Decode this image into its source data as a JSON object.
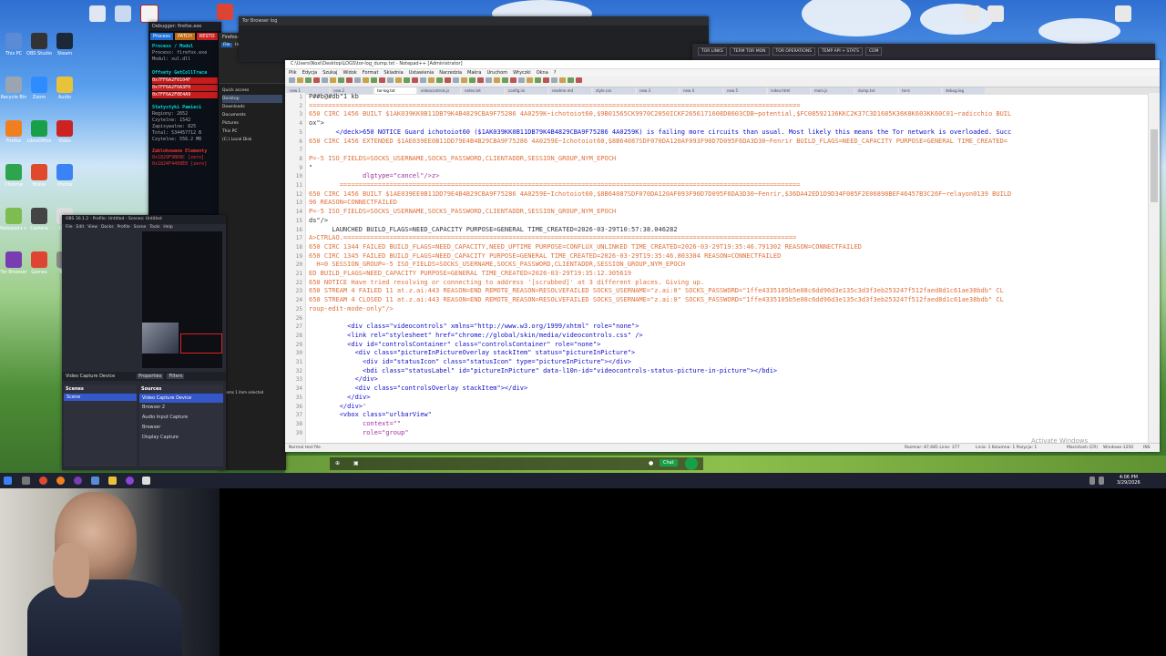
{
  "desktop": {
    "icon_labels": [
      "This PC",
      "Recycle Bin",
      "Firefox",
      "Chrome",
      "Notepad++",
      "Tor Browser",
      "OBS Studio",
      "Zoom",
      "LibreOffice",
      "Brave",
      "Camera",
      "Games",
      "Steam",
      "Audio",
      "Video",
      "Photos",
      "Docs",
      "Tools"
    ]
  },
  "debugger_window": {
    "title": "Debugger: firefox.exe",
    "tabs": [
      "Process",
      "PATCH",
      "RESTO"
    ],
    "module_header": "Process / Modul",
    "process_line": "Process: firefox.exe",
    "module_line": "Modul: xul.dll",
    "offsets_header": "Offsety GetCollTrace",
    "offsets": [
      "0x7FF6A2F0104F",
      "0x7FF6A2F0A3F0",
      "0x7FF6A2F0E4A9"
    ],
    "stats_header": "Statystyki Pamieci",
    "stats": [
      "Regiony: 2652",
      "Czytelne: 1542",
      "Zapisywalne: 825",
      "Total: 534457712 B",
      "Czytelne: 556.2 MB"
    ],
    "blocked_header": "Zablokowane Elementy",
    "blocked": [
      "0x1829F9BD8C [zero]",
      "0x1824F4499E0 [zero]"
    ]
  },
  "explorer": {
    "title": "Firefox-Installer.exe",
    "ribbon_tabs": [
      "File",
      "Home",
      "Share",
      "View"
    ],
    "nav_items": [
      "Quick access",
      "Desktop",
      "Downloads",
      "Documents",
      "Pictures",
      "This PC",
      "(C:) Local Disk"
    ],
    "status": "3 items  1 item selected"
  },
  "obs": {
    "title": "OBS 30.1.2 - Profile: Untitled - Scenes: Untitled",
    "menu": [
      "File",
      "Edit",
      "View",
      "Docks",
      "Profile",
      "Scene",
      "Tools",
      "Help"
    ],
    "source_label": "Video Capture Device",
    "properties_label": "Properties",
    "filters_label": "Filters",
    "scenes_header": "Scenes",
    "sources_header": "Sources",
    "scenes": [
      "Scene"
    ],
    "sources": [
      "Video Capture Device",
      "Browser 2",
      "Audio Input Capture",
      "Browser",
      "Display Capture"
    ]
  },
  "tor_log_window": {
    "title": "Tor Browser log"
  },
  "browser_strip": {
    "tabs": [
      "TOR LINKS",
      "TERM TOR MON",
      "TOR OPERATIONS",
      "TEMP API + STATS",
      "CDM"
    ]
  },
  "editor": {
    "title": "C:\\Users\\Noxi\\Desktop\\LOGS\\tor-log_dump.txt - Notepad++ [Administrator]",
    "menu": [
      "Plik",
      "Edycja",
      "Szukaj",
      "Widok",
      "Format",
      "Skladnia",
      "Ustawienia",
      "Narzedzia",
      "Makra",
      "Uruchom",
      "Wtyczki",
      "Okna",
      "?"
    ],
    "tabs": [
      "new 1",
      "new 2",
      "tor-log.txt",
      "videocontrols.js",
      "notes.txt",
      "config.ini",
      "readme.md",
      "style.css",
      "new 3",
      "new 4",
      "new 5",
      "index.html",
      "main.js",
      "dump.txt",
      "torrc",
      "debug.log"
    ],
    "active_tab": "tor-log.txt",
    "line_numbers": [
      "1",
      "2",
      "3",
      "4",
      "5",
      "6",
      "7",
      "8",
      "9",
      "10",
      "11",
      "12",
      "13",
      "14",
      "15",
      "16",
      "17",
      "18",
      "19",
      "20",
      "21",
      "22",
      "23",
      "24",
      "25",
      "26",
      "27",
      "28",
      "29",
      "30",
      "31",
      "32",
      "33",
      "34",
      "35",
      "36",
      "37",
      "38",
      "39"
    ],
    "lines": [
      "P##b@#db\"1 kb",
      "================================================================================================================================",
      "650 CIRC 1456 BUILT $1AK039KK0B11DB79K4B4829CBA9F75286 4A0259K~ichotoiot60,$9B01565CK9970C2050ICKF2656171608D8603CDB~potential,$FC08592136KKC2K37C3D1685K36K8K603KK60C01~radicchio BUIL",
      "ox\">",
      "       </deck>650 NOTICE Guard ichotoiot60 ($1AK039KK0B11DB79K4B4829CBA9F75286 4A0259K) is failing more circuits than usual. Most likely this means the Tor network is overloaded. Succ",
      "650 CIRC 1456 EXTENDED $1AE039EE0B11DD79E4B4B29CBA9F75286 4A0259E~Ichotoiot60,$8B64087SDF070DA120AF093F90D7D095F6DA3D30~Fenrir BUILD_FLAGS=NEED_CAPACITY PURPOSE=GENERAL TIME_CREATED=",
      "",
      "P=-5 ISO_FIELDS=SOCKS_USERNAME,SOCKS_PASSWORD,CLIENTADDR,SESSION_GROUP,NYM_EPOCH",
      "\"",
      "              dlgtype=\"cancel\"/>z>",
      "        ========================================================================================================================",
      "650 CIRC 1456 BUILT $1AE039EE0B11DD79E4B4B29CBA9F75286 4A0259E~Ichotoiot60,$8B64087SDF070DA120AF093F90D7D095F6DA3D30~Fenrir,$36DA42ED1D9D34F085F2E06898BEF46457B3C26F~relayon0139 BUILD",
      "96 REASON=CONNECTFAILED",
      "P=-5 ISO_FIELDS=SOCKS_USERNAME,SOCKS_PASSWORD,CLIENTADDR,SESSION_GROUP,NYM_EPOCH",
      "ds\"/>",
      "      LAUNCHED BUILD_FLAGS=NEED_CAPACITY PURPOSE=GENERAL TIME_CREATED=2026-03-29T10:57:38.046282",
      "A>CTRLAO.======================================================================================================================",
      "650 CIRC 1344 FAILED BUILD_FLAGS=NEED_CAPACITY,NEED_UPTIME PURPOSE=CONFLUX_UNLINKED TIME_CREATED=2026-03-29T19:35:46.791302 REASON=CONNECTFAILED",
      "650 CIRC 1345 FAILED BUILD_FLAGS=NEED_CAPACITY PURPOSE=GENERAL TIME_CREATED=2026-03-29T19:35:46.803304 REASON=CONNECTFAILED",
      "  H=0 SESSION_GROUP=-5 ISO_FIELDS=SOCKS_USERNAME,SOCKS_PASSWORD,CLIENTADDR,SESSION_GROUP,NYM_EPOCH",
      "ED BUILD_FLAGS=NEED_CAPACITY PURPOSE=GENERAL TIME_CREATED=2026-03-29T19:35:12.305619",
      "650 NOTICE Have tried resolving or connecting to address '[scrubbed]' at 3 different places. Giving up.",
      "650 STREAM 4 FAILED 11 at.z.ai:443 REASON=END REMOTE_REASON=RESOLVEFAILED SOCKS_USERNAME=\"z.ai:0\" SOCKS_PASSWORD=\"1ffe4335105b5e08c6dd96d3e135c3d3f3eb253247f512faed8d1c61ae38bdb\" CL",
      "650 STREAM 4 CLOSED 11 at.z.ai:443 REASON=END REMOTE_REASON=RESOLVEFAILED SOCKS_USERNAME=\"z.ai:0\" SOCKS_PASSWORD=\"1ffe4335105b5e08c6dd96d3e135c3d3f3eb253247f512faed8d1c61ae38bdb\" CL",
      "roup-edit-mode-only\"/>",
      "",
      "          <div class=\"videocontrols\" xmlns=\"http://www.w3.org/1999/xhtml\" role=\"none\">",
      "          <link rel=\"stylesheet\" href=\"chrome://global/skin/media/videocontrols.css\" />",
      "          <div id=\"controlsContainer\" class=\"controlsContainer\" role=\"none\">",
      "            <div class=\"pictureInPictureOverlay stackItem\" status=\"pictureInPicture\">",
      "              <div id=\"statusIcon\" class=\"statusIcon\" type=\"pictureInPicture\"></div>",
      "              <bdi class=\"statusLabel\" id=\"pictureInPicture\" data-l10n-id=\"videocontrols-status-picture-in-picture\"></bdi>",
      "            </div>",
      "            <div class=\"controlsOverlay stackItem\"></div>",
      "          </div>",
      "        </div>'",
      "        <vbox class=\"urlbarView\"",
      "              context=\"\"",
      "              role=\"group\""
    ],
    "status_left": "Normal text file",
    "status_mid": "Rozmiar: 87,685   Linie: 377",
    "status_pos": "Linia: 1   Kolumna: 1   Pozycja: 1",
    "status_eol": "Macintosh (CR)",
    "status_enc": "Windows-1250",
    "status_mode": "INS"
  },
  "activate_windows": "Activate Windows",
  "taskbar": {
    "chat_label": "Chat",
    "time": "4:06 PM",
    "date": "3/29/2026"
  },
  "colors": {
    "editor_bg": "#ffffff",
    "orange_text": "#e0703a",
    "blue_keyword": "#1010c8",
    "purple_attr": "#a030a0",
    "debugger_header": "#00c8c8",
    "chat_green": "#18a048"
  }
}
